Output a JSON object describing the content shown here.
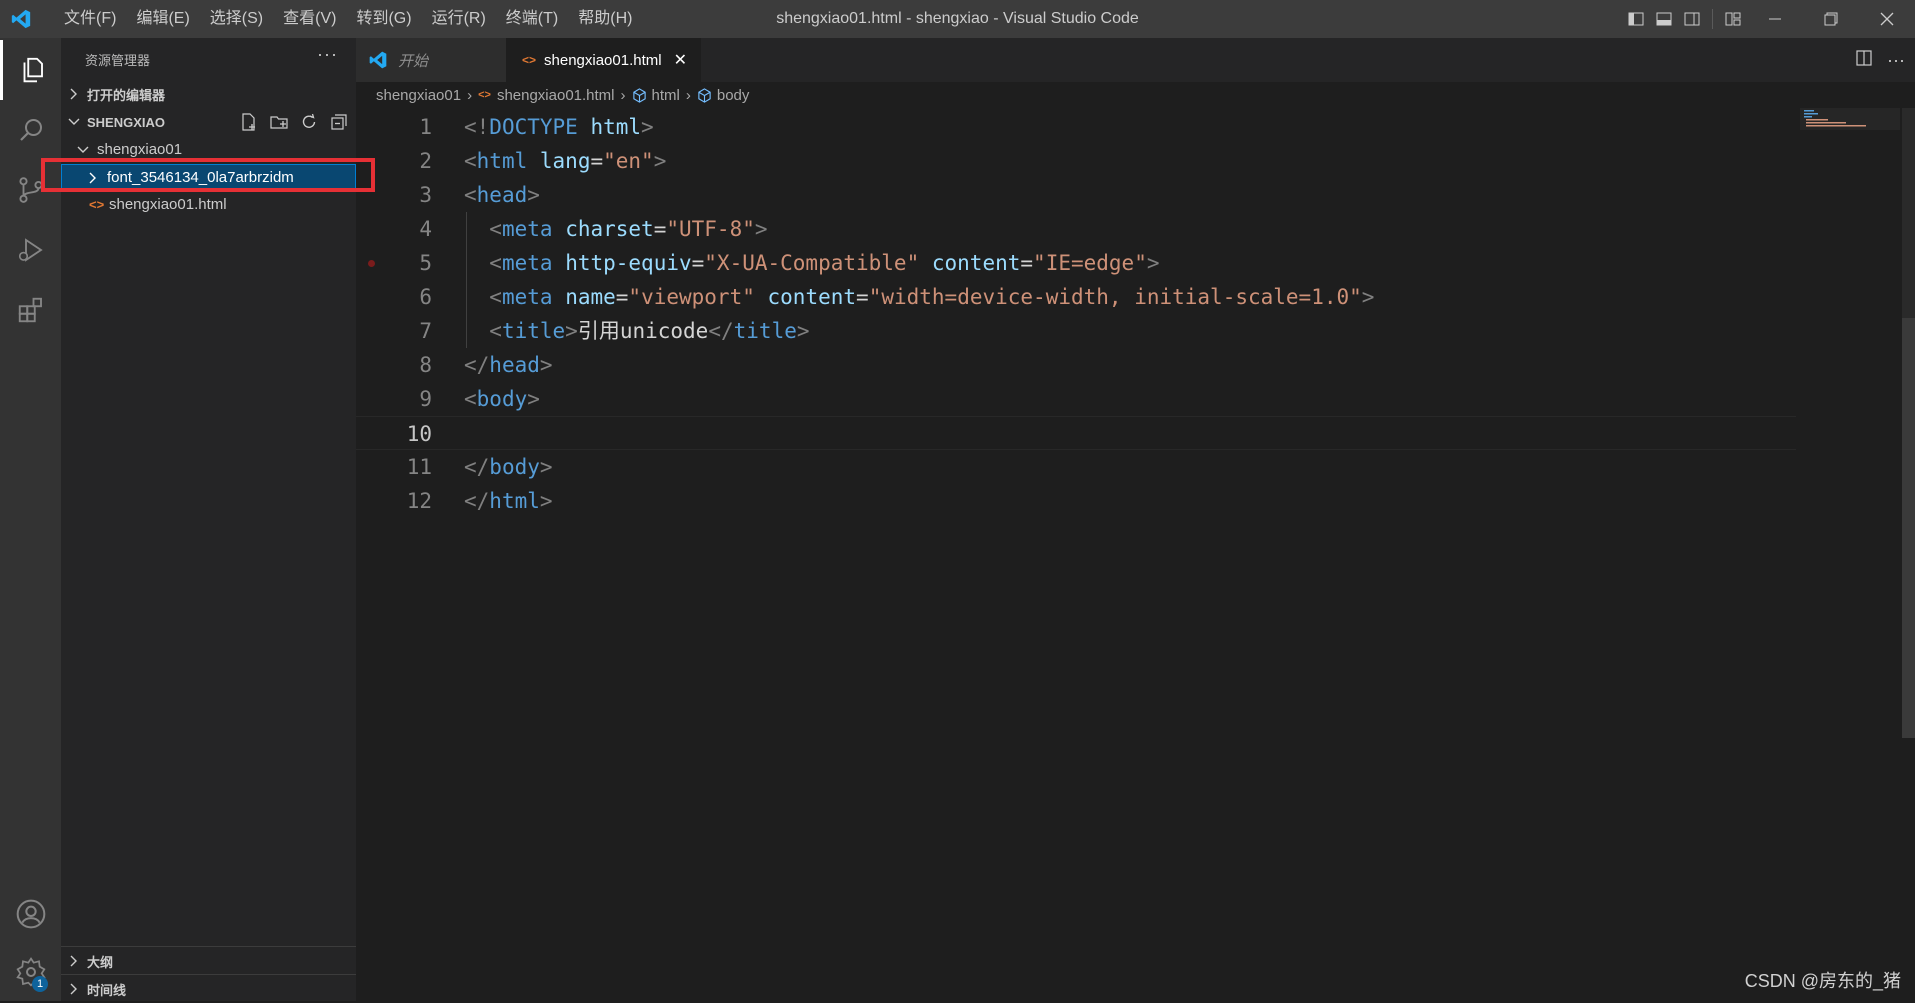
{
  "titlebar": {
    "menu": [
      "文件(F)",
      "编辑(E)",
      "选择(S)",
      "查看(V)",
      "转到(G)",
      "运行(R)",
      "终端(T)",
      "帮助(H)"
    ],
    "window_title": "shengxiao01.html - shengxiao - Visual Studio Code"
  },
  "activitybar": {
    "items": [
      "files-icon",
      "search-icon",
      "source-control-icon",
      "run-debug-icon",
      "extensions-icon"
    ],
    "accounts": "account-icon",
    "settings": "gear-icon",
    "settings_badge": "1"
  },
  "sidebar": {
    "title": "资源管理器",
    "more": "···",
    "open_editors": "打开的编辑器",
    "workspace": "SHENGXIAO",
    "tree": [
      {
        "label": "shengxiao01"
      },
      {
        "label": "font_3546134_0la7arbrzidm"
      },
      {
        "label": "shengxiao01.html"
      }
    ],
    "outline": "大纲",
    "timeline": "时间线"
  },
  "tabs": [
    {
      "label": "开始"
    },
    {
      "label": "shengxiao01.html",
      "close": "✕"
    }
  ],
  "breadcrumb": [
    "shengxiao01",
    "shengxiao01.html",
    "html",
    "body"
  ],
  "code": {
    "line_numbers": [
      "1",
      "2",
      "3",
      "4",
      "5",
      "6",
      "7",
      "8",
      "9",
      "10",
      "11",
      "12"
    ],
    "current_line": 10,
    "lines": [
      [
        [
          "t-br",
          "<!"
        ],
        [
          "t-tag",
          "DOCTYPE"
        ],
        [
          "t-txt",
          " "
        ],
        [
          "t-attr",
          "html"
        ],
        [
          "t-br",
          ">"
        ]
      ],
      [
        [
          "t-br",
          "<"
        ],
        [
          "t-tag",
          "html"
        ],
        [
          "t-txt",
          " "
        ],
        [
          "t-attr",
          "lang"
        ],
        [
          "t-eq",
          "="
        ],
        [
          "t-str",
          "\"en\""
        ],
        [
          "t-br",
          ">"
        ]
      ],
      [
        [
          "t-br",
          "<"
        ],
        [
          "t-tag",
          "head"
        ],
        [
          "t-br",
          ">"
        ]
      ],
      [
        [
          "t-txt",
          "  "
        ],
        [
          "t-br",
          "<"
        ],
        [
          "t-tag",
          "meta"
        ],
        [
          "t-txt",
          " "
        ],
        [
          "t-attr",
          "charset"
        ],
        [
          "t-eq",
          "="
        ],
        [
          "t-str",
          "\"UTF-8\""
        ],
        [
          "t-br",
          ">"
        ]
      ],
      [
        [
          "t-txt",
          "  "
        ],
        [
          "t-br",
          "<"
        ],
        [
          "t-tag",
          "meta"
        ],
        [
          "t-txt",
          " "
        ],
        [
          "t-attr",
          "http-equiv"
        ],
        [
          "t-eq",
          "="
        ],
        [
          "t-str",
          "\"X-UA-Compatible\""
        ],
        [
          "t-txt",
          " "
        ],
        [
          "t-attr",
          "content"
        ],
        [
          "t-eq",
          "="
        ],
        [
          "t-str",
          "\"IE=edge\""
        ],
        [
          "t-br",
          ">"
        ]
      ],
      [
        [
          "t-txt",
          "  "
        ],
        [
          "t-br",
          "<"
        ],
        [
          "t-tag",
          "meta"
        ],
        [
          "t-txt",
          " "
        ],
        [
          "t-attr",
          "name"
        ],
        [
          "t-eq",
          "="
        ],
        [
          "t-str",
          "\"viewport\""
        ],
        [
          "t-txt",
          " "
        ],
        [
          "t-attr",
          "content"
        ],
        [
          "t-eq",
          "="
        ],
        [
          "t-str",
          "\"width=device-width, initial-scale=1.0\""
        ],
        [
          "t-br",
          ">"
        ]
      ],
      [
        [
          "t-txt",
          "  "
        ],
        [
          "t-br",
          "<"
        ],
        [
          "t-tag",
          "title"
        ],
        [
          "t-br",
          ">"
        ],
        [
          "t-txt",
          "引用unicode"
        ],
        [
          "t-br",
          "</"
        ],
        [
          "t-tag",
          "title"
        ],
        [
          "t-br",
          ">"
        ]
      ],
      [
        [
          "t-br",
          "</"
        ],
        [
          "t-tag",
          "head"
        ],
        [
          "t-br",
          ">"
        ]
      ],
      [
        [
          "t-br",
          "<"
        ],
        [
          "t-tag",
          "body"
        ],
        [
          "t-br",
          ">"
        ]
      ],
      [],
      [
        [
          "t-br",
          "</"
        ],
        [
          "t-tag",
          "body"
        ],
        [
          "t-br",
          ">"
        ]
      ],
      [
        [
          "t-br",
          "</"
        ],
        [
          "t-tag",
          "html"
        ],
        [
          "t-br",
          ">"
        ]
      ]
    ]
  },
  "watermark": "CSDN @房东的_猪",
  "colors": {
    "titlebar": "#3c3c3c",
    "activitybar": "#333333",
    "sidebar": "#252526",
    "editor": "#1e1e1e",
    "selection": "#094771",
    "highlight_box": "#e63035",
    "html_icon": "#e37933"
  }
}
